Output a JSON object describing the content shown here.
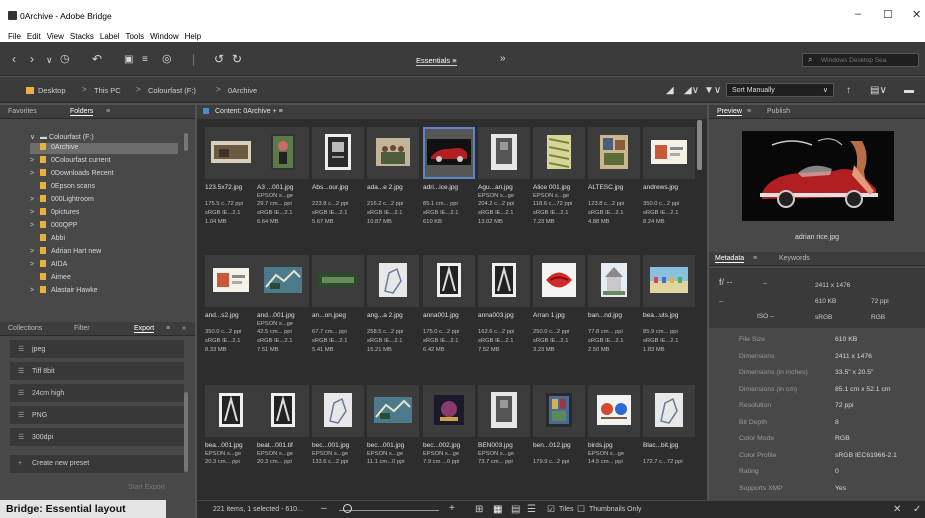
{
  "window": {
    "title": "0Archive - Adobe Bridge",
    "minimize": "–",
    "maximize": "☐",
    "close": "✕"
  },
  "menu": [
    "File",
    "Edit",
    "View",
    "Stacks",
    "Label",
    "Tools",
    "Window",
    "Help"
  ],
  "toolbar": {
    "workspace": "Essentials",
    "workspace_menu": "≡",
    "more": "»",
    "search_placeholder": "Windows Desktop Sea"
  },
  "path": {
    "items": [
      "Desktop",
      "This PC",
      "Colourfast (F:)",
      "0Archive"
    ],
    "separator": ">",
    "sort": "Sort Manually"
  },
  "left_panel": {
    "tabs": [
      "Favorites",
      "Folders",
      "≡"
    ],
    "tree_root": "Colourfast (F:)",
    "tree": [
      {
        "label": "0Archive",
        "selected": true,
        "arrow": ""
      },
      {
        "label": "0Colourfast current",
        "arrow": ">"
      },
      {
        "label": "0Downloads Recent",
        "arrow": ">"
      },
      {
        "label": "0Epson scans",
        "arrow": ""
      },
      {
        "label": "000Lightroom",
        "arrow": ">"
      },
      {
        "label": "0pictures",
        "arrow": ">"
      },
      {
        "label": "000QPP",
        "arrow": ">"
      },
      {
        "label": "Abbi",
        "arrow": ""
      },
      {
        "label": "Adrian Hart new",
        "arrow": ">"
      },
      {
        "label": "AIDA",
        "arrow": ">"
      },
      {
        "label": "Aimee",
        "arrow": ""
      },
      {
        "label": "Alastair Hawke",
        "arrow": ">"
      }
    ],
    "lower_tabs": [
      "Collections",
      "Filter",
      "Export",
      "≡",
      "»"
    ],
    "export_items": [
      "jpeg",
      "Tiff 8bit",
      "24cm high",
      "PNG",
      "300dpi"
    ],
    "create_preset": "Create new preset",
    "start_export": "Start Export"
  },
  "content": {
    "tab": "Content: 0Archive",
    "items": [
      {
        "name": "123.5x72.jpg",
        "m1": "",
        "m2": "175.5 c..72 ppi",
        "m3": "sRGB IE...2.1",
        "m4": "1.04 MB",
        "art": "paint"
      },
      {
        "name": "A3 ...001.jpg",
        "m1": "EPSON s...ge",
        "m2": "29.7 cm... ppi",
        "m3": "sRGB IE...2.1",
        "m4": "6.64 MB",
        "art": "figure"
      },
      {
        "name": "Abs...our.jpg",
        "m1": "",
        "m2": "223.8 c...2 ppi",
        "m3": "sRGB IE...2.1",
        "m4": "5.67 MB",
        "art": "poster"
      },
      {
        "name": "ada...e 2.jpg",
        "m1": "",
        "m2": "216.2 c...2 ppi",
        "m3": "sRGB IE...2.1",
        "m4": "10.87 MB",
        "art": "group"
      },
      {
        "name": "adri...ice.jpg",
        "m1": "",
        "m2": "85.1 cm... ppi",
        "m3": "sRGB IE...2.1",
        "m4": "610 KB",
        "art": "car",
        "selected": true
      },
      {
        "name": "Agu...an.jpg",
        "m1": "EPSON s...ge",
        "m2": "204.2 c...2 ppi",
        "m3": "sRGB IE...2.1",
        "m4": "13.02 MB",
        "art": "tall"
      },
      {
        "name": "Alice 001.jpg",
        "m1": "EPSON s...ge",
        "m2": "118.6 c...72 ppi",
        "m3": "sRGB IE...2.1",
        "m4": "7.23 MB",
        "art": "pattern"
      },
      {
        "name": "ALTESC.jpg",
        "m1": "",
        "m2": "123.8 c...2 ppi",
        "m3": "sRGB IE...2.1",
        "m4": "4.88 MB",
        "art": "collage"
      },
      {
        "name": "andrews.jpg",
        "m1": "",
        "m2": "350.0 c...2 ppi",
        "m3": "sRGB IE...2.1",
        "m4": "8.24 MB",
        "art": "card"
      },
      {
        "name": "and...s2.jpg",
        "m1": "",
        "m2": "350.0 c...2 ppi",
        "m3": "sRGB IE...2.1",
        "m4": "8.33 MB",
        "art": "card"
      },
      {
        "name": "and...001.jpg",
        "m1": "EPSON s...ge",
        "m2": "42.5 cm... ppi",
        "m3": "sRGB IE...2.1",
        "m4": "7.51 MB",
        "art": "map"
      },
      {
        "name": "an...on.jpeg",
        "m1": "",
        "m2": "67.7 cm... ppi",
        "m3": "sRGB IE...2.1",
        "m4": "5.41 MB",
        "art": "banner"
      },
      {
        "name": "ang...a 2.jpg",
        "m1": "",
        "m2": "258.5 c...2 ppi",
        "m3": "sRGB IE...2.1",
        "m4": "15.21 MB",
        "art": "sketch"
      },
      {
        "name": "anna001.jpg",
        "m1": "",
        "m2": "175.0 c...2 ppi",
        "m3": "sRGB IE...2.1",
        "m4": "6.42 MB",
        "art": "bw"
      },
      {
        "name": "anna003.jpg",
        "m1": "",
        "m2": "162.6 c...2 ppi",
        "m3": "sRGB IE...2.1",
        "m4": "7.52 MB",
        "art": "bw"
      },
      {
        "name": "Arran 1.jpg",
        "m1": "",
        "m2": "250.0 c...2 ppi",
        "m3": "sRGB IE...2.1",
        "m4": "3.23 MB",
        "art": "lips"
      },
      {
        "name": "ban...nd.jpg",
        "m1": "",
        "m2": "77.8 cm... ppi",
        "m3": "sRGB IE...2.1",
        "m4": "2.50 MB",
        "art": "bandstand"
      },
      {
        "name": "bea...uts.jpg",
        "m1": "",
        "m2": "85.9 cm... ppi",
        "m3": "sRGB IE...2.1",
        "m4": "1.83 MB",
        "art": "beach"
      },
      {
        "name": "bea...001.jpg",
        "m1": "EPSON s...ge",
        "m2": "20.3 cm... ppi",
        "m3": "",
        "m4": "",
        "art": "bw"
      },
      {
        "name": "beat...001.tif",
        "m1": "EPSON s...ge",
        "m2": "20.3 cm... ppi",
        "m3": "",
        "m4": "",
        "art": "bw"
      },
      {
        "name": "bec...001.jpg",
        "m1": "EPSON s...ge",
        "m2": "133.6 c...2 ppi",
        "m3": "",
        "m4": "",
        "art": "sketch"
      },
      {
        "name": "bec...001.jpg",
        "m1": "EPSON s...ge",
        "m2": "11.1 cm...0 ppi",
        "m3": "",
        "m4": "",
        "art": "map"
      },
      {
        "name": "bec...002.jpg",
        "m1": "EPSON s...ge",
        "m2": "7.9 cm ...0 ppi",
        "m3": "",
        "m4": "",
        "art": "dark"
      },
      {
        "name": "BEN003.jpg",
        "m1": "EPSON s...ge",
        "m2": "73.7 cm... ppi",
        "m3": "",
        "m4": "",
        "art": "tall"
      },
      {
        "name": "ben...012.jpg",
        "m1": "",
        "m2": "179.9 c...2 ppi",
        "m3": "",
        "m4": "",
        "art": "window"
      },
      {
        "name": "birds.jpg",
        "m1": "EPSON s...ge",
        "m2": "14.5 cm... ppi",
        "m3": "",
        "m4": "",
        "art": "birds"
      },
      {
        "name": "Blac...bit.jpg",
        "m1": "",
        "m2": "172.7 c...72 ppi",
        "m3": "",
        "m4": "",
        "art": "sketch"
      }
    ]
  },
  "status": {
    "count": "221 items, 1 selected - 610...",
    "tiles": "Tiles",
    "thumbs_only": "Thumbnails Only",
    "minus": "–",
    "plus": "+"
  },
  "preview": {
    "tabs": [
      "Preview",
      "≡",
      "Publish"
    ],
    "caption": "adrian rice.jpg"
  },
  "metadata": {
    "tabs": [
      "Metadata",
      "≡",
      "Keywords"
    ],
    "summary": {
      "aperture": "f/ --",
      "dash1": "--",
      "dash2": "--",
      "iso": "ISO --",
      "dims": "2411 x 1476",
      "size": "610 KB",
      "ppi": "72 ppi",
      "cs1": "sRGB",
      "cs2": "RGB"
    },
    "rows": [
      {
        "k": "File Size",
        "v": "610 KB"
      },
      {
        "k": "Dimensions",
        "v": "2411 x 1476"
      },
      {
        "k": "Dimensions (in inches)",
        "v": "33.5\" x 20.5\""
      },
      {
        "k": "Dimensions (in cm)",
        "v": "85.1 cm x 52.1 cm"
      },
      {
        "k": "Resolution",
        "v": "72 ppi"
      },
      {
        "k": "Bit Depth",
        "v": "8"
      },
      {
        "k": "Color Mode",
        "v": "RGB"
      },
      {
        "k": "Color Profile",
        "v": "sRGB IEC61966-2.1"
      },
      {
        "k": "Rating",
        "v": "0"
      },
      {
        "k": "Supports XMP",
        "v": "Yes"
      }
    ]
  },
  "caption": "Bridge: Essential layout"
}
